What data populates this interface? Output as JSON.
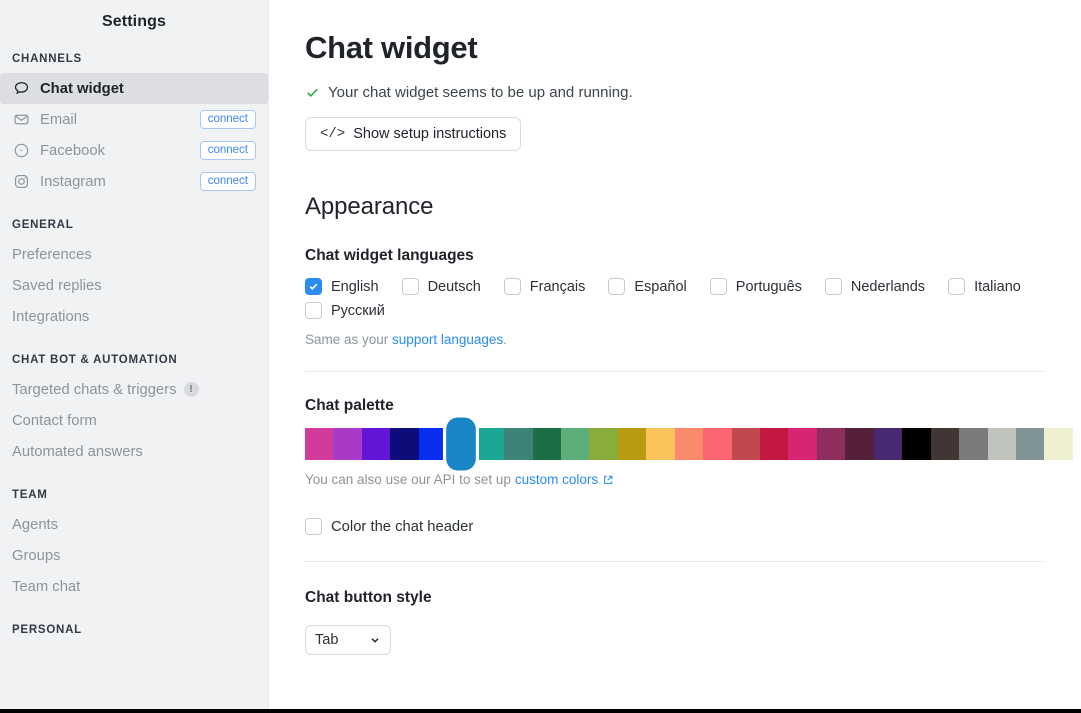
{
  "sidebar": {
    "title": "Settings",
    "groups": [
      {
        "label": "CHANNELS",
        "items": [
          {
            "label": "Chat widget",
            "icon": "chat-bubble-icon",
            "active": true,
            "action": null
          },
          {
            "label": "Email",
            "icon": "envelope-icon",
            "active": false,
            "action": "connect"
          },
          {
            "label": "Facebook",
            "icon": "messenger-icon",
            "active": false,
            "action": "connect"
          },
          {
            "label": "Instagram",
            "icon": "instagram-icon",
            "active": false,
            "action": "connect"
          }
        ]
      },
      {
        "label": "GENERAL",
        "items": [
          {
            "label": "Preferences",
            "icon": null,
            "active": false,
            "action": null
          },
          {
            "label": "Saved replies",
            "icon": null,
            "active": false,
            "action": null
          },
          {
            "label": "Integrations",
            "icon": null,
            "active": false,
            "action": null
          }
        ]
      },
      {
        "label": "CHAT BOT & AUTOMATION",
        "items": [
          {
            "label": "Targeted chats & triggers",
            "icon": null,
            "active": false,
            "action": null,
            "badge": "!"
          },
          {
            "label": "Contact form",
            "icon": null,
            "active": false,
            "action": null
          },
          {
            "label": "Automated answers",
            "icon": null,
            "active": false,
            "action": null
          }
        ]
      },
      {
        "label": "TEAM",
        "items": [
          {
            "label": "Agents",
            "icon": null,
            "active": false,
            "action": null
          },
          {
            "label": "Groups",
            "icon": null,
            "active": false,
            "action": null
          },
          {
            "label": "Team chat",
            "icon": null,
            "active": false,
            "action": null
          }
        ]
      },
      {
        "label": "PERSONAL",
        "items": []
      }
    ]
  },
  "main": {
    "page_title": "Chat widget",
    "status_text": "Your chat widget seems to be up and running.",
    "status_icon": "check-icon",
    "setup_button_label": "Show setup instructions",
    "setup_button_icon": "code-icon",
    "appearance_heading": "Appearance",
    "languages": {
      "heading": "Chat widget languages",
      "options": [
        {
          "label": "English",
          "checked": true
        },
        {
          "label": "Deutsch",
          "checked": false
        },
        {
          "label": "Français",
          "checked": false
        },
        {
          "label": "Español",
          "checked": false
        },
        {
          "label": "Português",
          "checked": false
        },
        {
          "label": "Nederlands",
          "checked": false
        },
        {
          "label": "Italiano",
          "checked": false
        },
        {
          "label": "Русский",
          "checked": false
        }
      ],
      "hint_prefix": "Same as your ",
      "hint_link": "support languages",
      "hint_suffix": "."
    },
    "palette": {
      "heading": "Chat palette",
      "selected_index": 5,
      "selected_color": "#1a86c8",
      "swatches": [
        "#d13b9c",
        "#a93ac6",
        "#6315d6",
        "#0d0d7a",
        "#0a2ef0",
        "#1a86c8",
        "#1aa894",
        "#3e8179",
        "#1a7044",
        "#5caf7b",
        "#8aae3c",
        "#b89b10",
        "#f9c25b",
        "#fb8a6d",
        "#fb6471",
        "#c1484f",
        "#c21841",
        "#d62573",
        "#8d2e5e",
        "#57203a",
        "#472a72",
        "#000000",
        "#413634",
        "#7b7b7b",
        "#bfc4bd",
        "#809496",
        "#eff0cf"
      ],
      "hint_prefix": "You can also use our API to set up ",
      "hint_link": "custom colors",
      "hint_link_icon": "external-link-icon"
    },
    "color_header": {
      "label": "Color the chat header",
      "checked": false
    },
    "button_style": {
      "heading": "Chat button style",
      "value": "Tab",
      "chevron_icon": "chevron-down-icon"
    }
  }
}
